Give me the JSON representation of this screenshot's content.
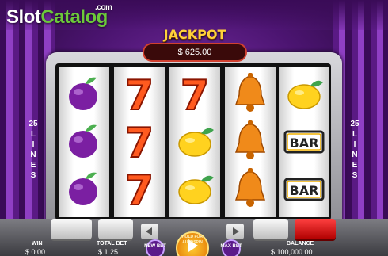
{
  "logo": {
    "part1": "Slot",
    "part2": "Catalog",
    "suffix": ".com"
  },
  "jackpot": {
    "title": "JACKPOT",
    "amount": "$ 625.00"
  },
  "lines": {
    "left": [
      "25",
      "L",
      "I",
      "N",
      "E",
      "S"
    ],
    "right": [
      "25",
      "L",
      "I",
      "N",
      "E",
      "S"
    ]
  },
  "reels": [
    [
      "plum",
      "plum",
      "plum"
    ],
    [
      "seven",
      "seven",
      "seven"
    ],
    [
      "seven",
      "lemon",
      "lemon"
    ],
    [
      "bell",
      "bell",
      "bell"
    ],
    [
      "lemon",
      "bar",
      "bar"
    ]
  ],
  "symbol_text": {
    "bar": "BAR",
    "seven": "7"
  },
  "footer": {
    "win_label": "WIN",
    "win_value": "$ 0.00",
    "total_bet_label": "TOTAL BET",
    "total_bet_value": "$ 1.25",
    "new_bet_label": "NEW BET",
    "spin_label": "HOLD FOR AUTOSPIN",
    "max_bet_label": "MAX BET",
    "balance_label": "BALANCE",
    "balance_value": "$ 100,000.00"
  },
  "colors": {
    "accent": "#ffd23a",
    "logo_green": "#6cc93a",
    "jackpot_border": "#d04030"
  }
}
